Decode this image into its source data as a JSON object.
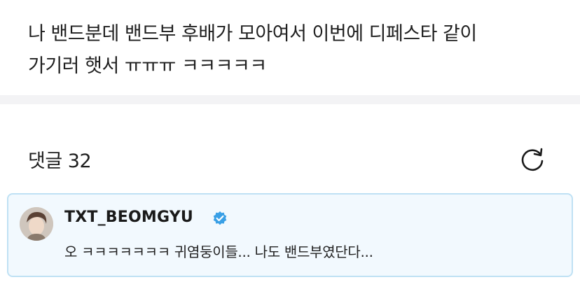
{
  "post": {
    "text_line1": "나 밴드분데 밴드부 후배가 모아여서 이번에 디페스타 같이",
    "text_line2": "가기러 햇서 ㅠㅠㅠ ㅋㅋㅋㅋㅋ"
  },
  "comments": {
    "header_label": "댓글 32",
    "refresh_icon": "refresh-icon",
    "featured": {
      "author": "TXT_BEOMGYU",
      "verified_icon": "verified-badge-icon",
      "body": "오 ㅋㅋㅋㅋㅋㅋㅋ 귀염둥이들... 나도 밴드부였단다..."
    }
  },
  "colors": {
    "card_border": "#bfe1f4",
    "card_bg": "#f2f9fe",
    "verified_blue": "#3aa0e6",
    "divider": "#f3f3f5"
  }
}
